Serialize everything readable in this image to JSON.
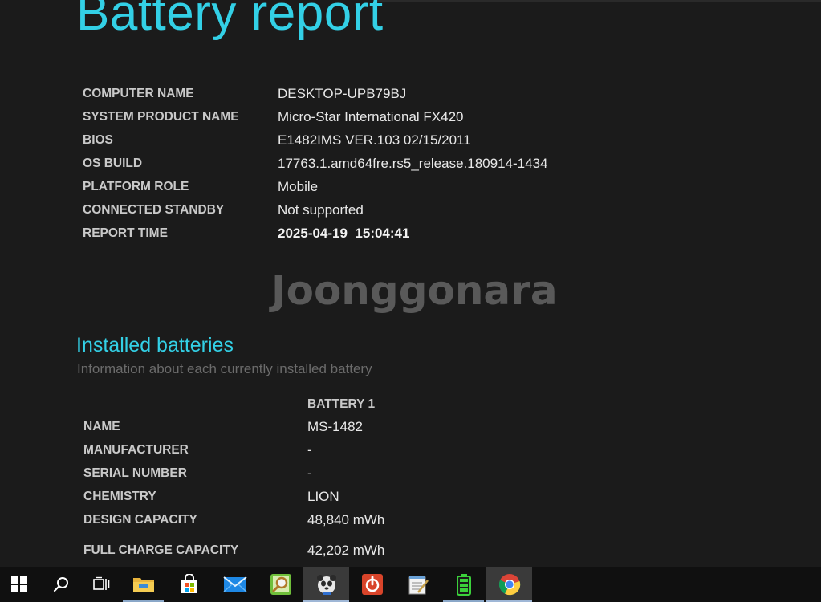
{
  "report": {
    "title": "Battery report"
  },
  "system_info": [
    {
      "label": "COMPUTER NAME",
      "value": "DESKTOP-UPB79BJ"
    },
    {
      "label": "SYSTEM PRODUCT NAME",
      "value": "Micro-Star International FX420"
    },
    {
      "label": "BIOS",
      "value": "E1482IMS VER.103 02/15/2011"
    },
    {
      "label": "OS BUILD",
      "value": "17763.1.amd64fre.rs5_release.180914-1434"
    },
    {
      "label": "PLATFORM ROLE",
      "value": "Mobile"
    },
    {
      "label": "CONNECTED STANDBY",
      "value": "Not supported"
    },
    {
      "label": "REPORT TIME",
      "value": "2025-04-19  15:04:41"
    }
  ],
  "watermark": {
    "text": "Joonggonara"
  },
  "installed_batteries": {
    "title": "Installed batteries",
    "subtitle": "Information about each currently installed battery",
    "column_header": "BATTERY 1",
    "rows": [
      {
        "label": "NAME",
        "value": "MS-1482"
      },
      {
        "label": "MANUFACTURER",
        "value": "-"
      },
      {
        "label": "SERIAL NUMBER",
        "value": "-"
      },
      {
        "label": "CHEMISTRY",
        "value": "LION"
      },
      {
        "label": "DESIGN CAPACITY",
        "value": "48,840 mWh"
      },
      {
        "label": "FULL CHARGE CAPACITY",
        "value": "42,202 mWh"
      }
    ]
  },
  "taskbar": {
    "items": [
      {
        "icon": "windows-start-icon"
      },
      {
        "icon": "search-icon"
      },
      {
        "icon": "task-view-icon"
      },
      {
        "icon": "file-explorer-icon"
      },
      {
        "icon": "microsoft-store-icon"
      },
      {
        "icon": "mail-icon"
      },
      {
        "icon": "map-search-app-icon"
      },
      {
        "icon": "panda-app-icon"
      },
      {
        "icon": "power-app-icon"
      },
      {
        "icon": "notepad-icon"
      },
      {
        "icon": "green-battery-app-icon"
      },
      {
        "icon": "chrome-icon"
      }
    ]
  },
  "colors": {
    "background": "#1b1b1b",
    "accent": "#33d0e6",
    "label": "#c9c9c9",
    "value": "#e8e8e8",
    "subtitle": "#6b6b6b",
    "taskbar": "#101010"
  }
}
